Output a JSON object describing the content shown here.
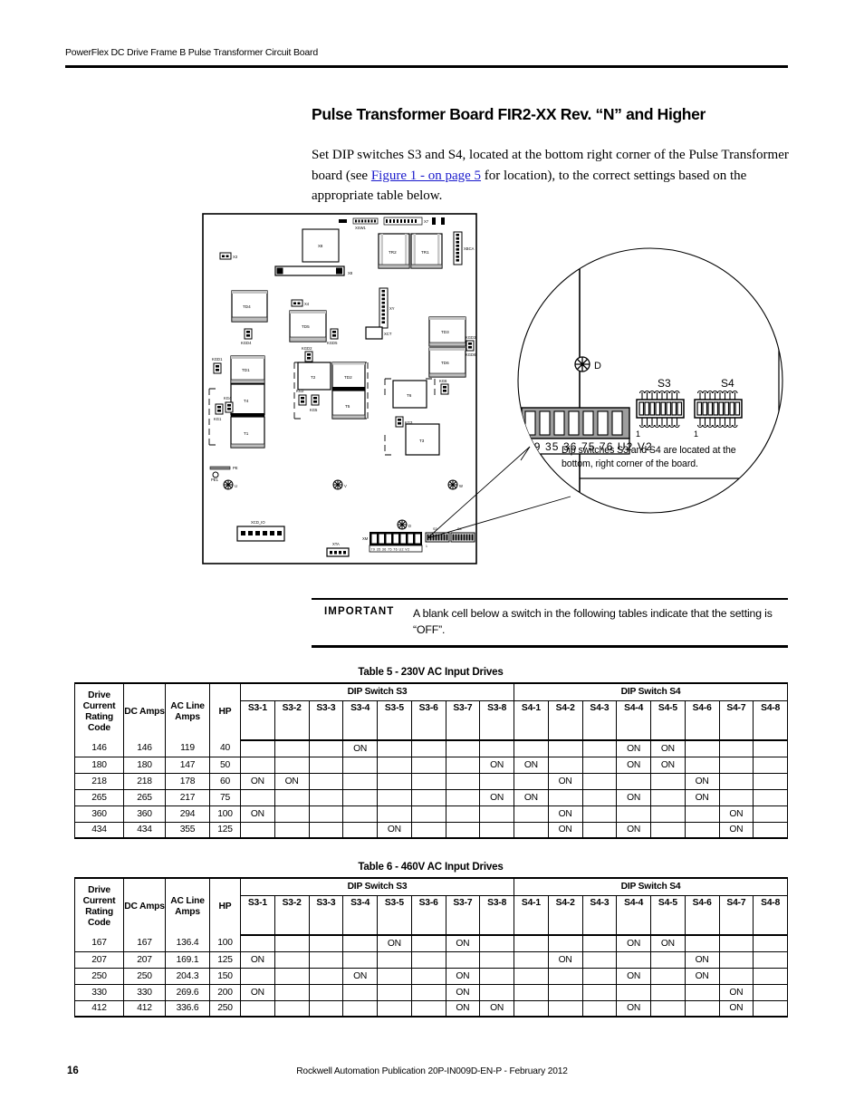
{
  "header": {
    "running_head": "PowerFlex DC Drive Frame B Pulse Transformer Circuit Board"
  },
  "title": "Pulse Transformer Board FIR2-XX Rev. “N” and Higher",
  "intro": {
    "part1": "Set DIP switches S3 and S4, located at the bottom right corner of the Pulse Transformer board (see ",
    "link": "Figure 1 - on page 5",
    "part2": " for location), to the correct settings based on the appropriate table below."
  },
  "figure": {
    "callout_note": "Dip switches S3 and S4 are located at the bottom, right corner of the board.",
    "detail": {
      "screw_label": "D",
      "switch_labels": [
        "S3",
        "S4"
      ],
      "switch_pin_one": "1",
      "terminal_labels": [
        "79",
        "35",
        "36",
        "75",
        "76",
        "U2",
        "V2"
      ]
    },
    "board_components": [
      "X3",
      "X8",
      "XSW1",
      "X7",
      "TR2",
      "TR1",
      "XBCA",
      "X4",
      "XY",
      "XCT",
      "TD4",
      "TD5",
      "TD3",
      "TD6",
      "TD1",
      "T4",
      "T1",
      "T2",
      "T6",
      "T5",
      "T3",
      "KGD1",
      "KGD4",
      "KGD5",
      "KGD2",
      "KGD3",
      "KGD6",
      "KG1",
      "KG4",
      "KG2",
      "KG5",
      "KG3",
      "PE",
      "XCD_IO",
      "XTA",
      "XM",
      "U",
      "V",
      "W",
      "C",
      "D",
      "S3",
      "S4"
    ],
    "board_terminal_labels": [
      "79",
      "35",
      "36",
      "75",
      "76",
      "U2",
      "V2"
    ]
  },
  "important": {
    "label": "IMPORTANT",
    "text": "A blank cell below a switch in the following tables indicate that the setting is “OFF”."
  },
  "on_label": "ON",
  "tables": [
    {
      "id": "table5",
      "caption": "Table 5 - 230V AC Input Drives",
      "stub_headers": [
        "Drive Current Rating Code",
        "DC Amps",
        "AC Line Amps",
        "HP"
      ],
      "group_headers": [
        "DIP Switch S3",
        "DIP Switch S4"
      ],
      "switch_headers": [
        "S3-1",
        "S3-2",
        "S3-3",
        "S3-4",
        "S3-5",
        "S3-6",
        "S3-7",
        "S3-8",
        "S4-1",
        "S4-2",
        "S4-3",
        "S4-4",
        "S4-5",
        "S4-6",
        "S4-7",
        "S4-8"
      ],
      "rows": [
        {
          "code": "146",
          "dc_amps": "146",
          "ac_line_amps": "119",
          "hp": "40",
          "switches": [
            "",
            "",
            "",
            "ON",
            "",
            "",
            "",
            "",
            "",
            "",
            "",
            "ON",
            "ON",
            "",
            "",
            ""
          ]
        },
        {
          "code": "180",
          "dc_amps": "180",
          "ac_line_amps": "147",
          "hp": "50",
          "switches": [
            "",
            "",
            "",
            "",
            "",
            "",
            "",
            "ON",
            "ON",
            "",
            "",
            "ON",
            "ON",
            "",
            "",
            ""
          ]
        },
        {
          "code": "218",
          "dc_amps": "218",
          "ac_line_amps": "178",
          "hp": "60",
          "switches": [
            "ON",
            "ON",
            "",
            "",
            "",
            "",
            "",
            "",
            "",
            "ON",
            "",
            "",
            "",
            "ON",
            "",
            ""
          ]
        },
        {
          "code": "265",
          "dc_amps": "265",
          "ac_line_amps": "217",
          "hp": "75",
          "switches": [
            "",
            "",
            "",
            "",
            "",
            "",
            "",
            "ON",
            "ON",
            "",
            "",
            "ON",
            "",
            "ON",
            "",
            ""
          ]
        },
        {
          "code": "360",
          "dc_amps": "360",
          "ac_line_amps": "294",
          "hp": "100",
          "switches": [
            "ON",
            "",
            "",
            "",
            "",
            "",
            "",
            "",
            "",
            "ON",
            "",
            "",
            "",
            "",
            "ON",
            ""
          ]
        },
        {
          "code": "434",
          "dc_amps": "434",
          "ac_line_amps": "355",
          "hp": "125",
          "switches": [
            "",
            "",
            "",
            "",
            "ON",
            "",
            "",
            "",
            "",
            "ON",
            "",
            "ON",
            "",
            "",
            "ON",
            ""
          ]
        }
      ]
    },
    {
      "id": "table6",
      "caption": "Table 6 - 460V AC Input Drives",
      "stub_headers": [
        "Drive Current Rating Code",
        "DC Amps",
        "AC Line Amps",
        "HP"
      ],
      "group_headers": [
        "DIP Switch S3",
        "DIP Switch S4"
      ],
      "switch_headers": [
        "S3-1",
        "S3-2",
        "S3-3",
        "S3-4",
        "S3-5",
        "S3-6",
        "S3-7",
        "S3-8",
        "S4-1",
        "S4-2",
        "S4-3",
        "S4-4",
        "S4-5",
        "S4-6",
        "S4-7",
        "S4-8"
      ],
      "rows": [
        {
          "code": "167",
          "dc_amps": "167",
          "ac_line_amps": "136.4",
          "hp": "100",
          "switches": [
            "",
            "",
            "",
            "",
            "ON",
            "",
            "ON",
            "",
            "",
            "",
            "",
            "ON",
            "ON",
            "",
            "",
            ""
          ]
        },
        {
          "code": "207",
          "dc_amps": "207",
          "ac_line_amps": "169.1",
          "hp": "125",
          "switches": [
            "ON",
            "",
            "",
            "",
            "",
            "",
            "",
            "",
            "",
            "ON",
            "",
            "",
            "",
            "ON",
            "",
            ""
          ]
        },
        {
          "code": "250",
          "dc_amps": "250",
          "ac_line_amps": "204.3",
          "hp": "150",
          "switches": [
            "",
            "",
            "",
            "ON",
            "",
            "",
            "ON",
            "",
            "",
            "",
            "",
            "ON",
            "",
            "ON",
            "",
            ""
          ]
        },
        {
          "code": "330",
          "dc_amps": "330",
          "ac_line_amps": "269.6",
          "hp": "200",
          "switches": [
            "ON",
            "",
            "",
            "",
            "",
            "",
            "ON",
            "",
            "",
            "",
            "",
            "",
            "",
            "",
            "ON",
            ""
          ]
        },
        {
          "code": "412",
          "dc_amps": "412",
          "ac_line_amps": "336.6",
          "hp": "250",
          "switches": [
            "",
            "",
            "",
            "",
            "",
            "",
            "ON",
            "ON",
            "",
            "",
            "",
            "ON",
            "",
            "",
            "ON",
            ""
          ]
        }
      ]
    }
  ],
  "footer": {
    "page_number": "16",
    "publication": "Rockwell Automation Publication 20P-IN009D-EN-P - February 2012"
  }
}
